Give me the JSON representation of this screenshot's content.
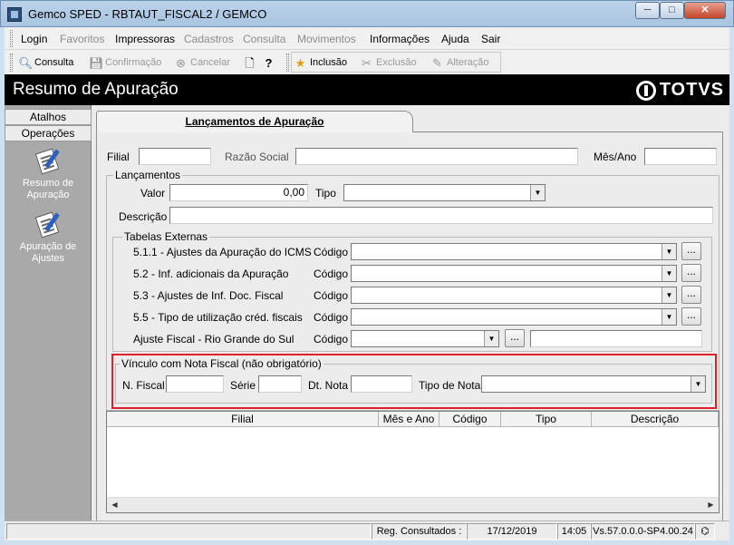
{
  "window": {
    "title": "Gemco SPED - RBTAUT_FISCAL2 / GEMCO",
    "min_label": "─",
    "max_label": "□",
    "close_label": "✕"
  },
  "menu": {
    "items": [
      {
        "label": "Login",
        "enabled": true
      },
      {
        "label": "Favoritos",
        "enabled": false
      },
      {
        "label": "Impressoras",
        "enabled": true
      },
      {
        "label": "Cadastros",
        "enabled": false
      },
      {
        "label": "Consulta",
        "enabled": false
      },
      {
        "label": "Movimentos",
        "enabled": false
      },
      {
        "label": "Informações",
        "enabled": true
      },
      {
        "label": "Ajuda",
        "enabled": true
      },
      {
        "label": "Sair",
        "enabled": true
      }
    ]
  },
  "toolbar": {
    "consulta": "Consulta",
    "confirmacao": "Confirmação",
    "cancelar": "Cancelar",
    "inclusao": "Inclusão",
    "exclusao": "Exclusão",
    "alteracao": "Alteração"
  },
  "header": {
    "screen_title": "Resumo de Apuração",
    "logo_text": "TOTVS"
  },
  "sidebar": {
    "tab_atalhos": "Atalhos",
    "tab_operacoes": "Operações",
    "items": [
      {
        "label_line1": "Resumo de",
        "label_line2": "Apuração",
        "icon": "document-pen-icon"
      },
      {
        "label_line1": "Apuração de",
        "label_line2": "Ajustes",
        "icon": "document-pen-icon"
      }
    ]
  },
  "tab": {
    "label": "Lançamentos de Apuração"
  },
  "form": {
    "filial_label": "Filial",
    "filial_value": "",
    "razao_label": "Razão Social",
    "razao_value": "",
    "mesano_label": "Mês/Ano",
    "mesano_value": "",
    "lancamentos_group": "Lançamentos",
    "valor_label": "Valor",
    "valor_value": "0,00",
    "tipo_label": "Tipo",
    "tipo_value": "",
    "descricao_label": "Descrição",
    "descricao_value": "",
    "tabelas_group": "Tabelas Externas",
    "codigo_label": "Código",
    "ellipsis": "...",
    "tabelas": [
      {
        "label": "5.1.1 - Ajustes da Apuração do ICMS",
        "value": ""
      },
      {
        "label": "5.2 - Inf. adicionais da Apuração",
        "value": ""
      },
      {
        "label": "5.3 - Ajustes de Inf. Doc. Fiscal",
        "value": ""
      },
      {
        "label": "5.5 - Tipo de utilização créd. fiscais",
        "value": ""
      }
    ],
    "ajuste_label": "Ajuste Fiscal - Rio Grande do Sul",
    "ajuste_value": "",
    "ajuste_desc_value": "",
    "vinculo_group": "Vínculo com Nota Fiscal (não obrigatório)",
    "nfiscal_label": "N. Fiscal",
    "nfiscal_value": "",
    "serie_label": "Série",
    "serie_value": "",
    "dtnota_label": "Dt. Nota",
    "dtnota_value": "",
    "tiponota_label": "Tipo de Nota",
    "tiponota_value": ""
  },
  "grid": {
    "columns": [
      "",
      "Filial",
      "Mês e Ano",
      "Código",
      "Tipo",
      "Descrição"
    ],
    "rows": []
  },
  "status": {
    "reg_consultados": "Reg. Consultados :",
    "date": "17/12/2019",
    "time": "14:05",
    "version": "Vs.57.0.0.0-SP4.00.24"
  }
}
